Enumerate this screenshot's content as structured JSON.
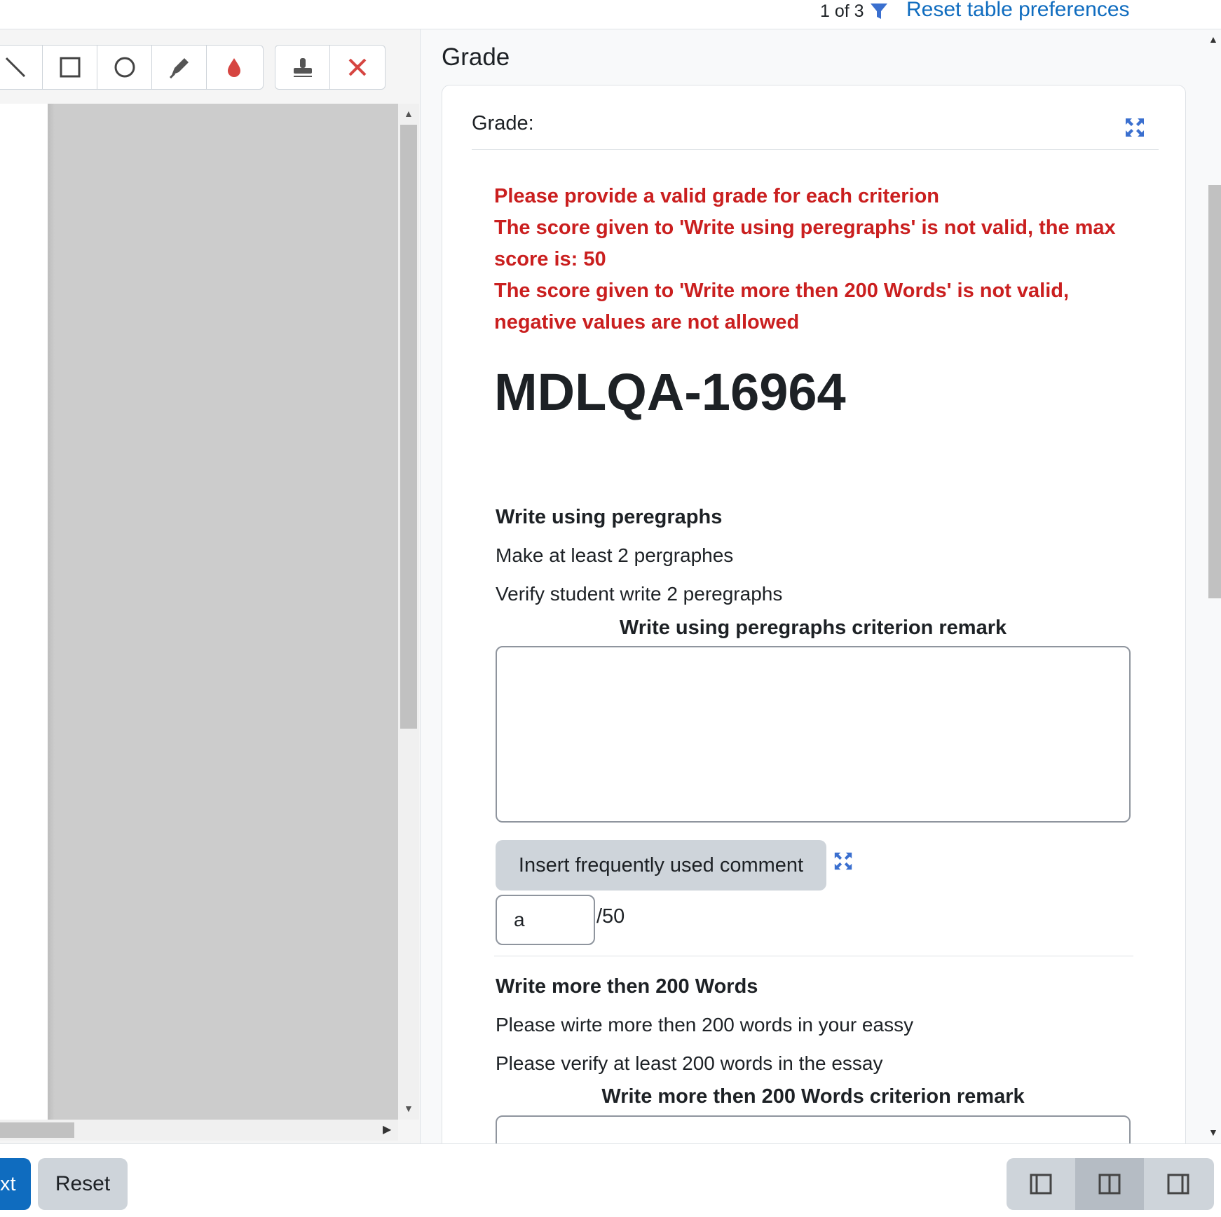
{
  "topbar": {
    "count": "1 of 3",
    "reset_link": "Reset table preferences"
  },
  "toolbar": {
    "tools": [
      "line-icon",
      "rectangle-icon",
      "oval-icon",
      "highlighter-icon",
      "color-picker-icon"
    ],
    "tools2": [
      "stamp-icon",
      "delete-icon"
    ]
  },
  "grade": {
    "heading": "Grade",
    "card_label": "Grade:",
    "errors": [
      "Please provide a valid grade for each criterion",
      "The score given to 'Write using peregraphs' is not valid, the max score is: 50",
      "The score given to 'Write more then 200 Words' is not valid, negative values are not allowed"
    ],
    "title": "MDLQA-16964",
    "criteria": [
      {
        "title": "Write using peregraphs",
        "description": "Make at least 2 pergraphes",
        "guidance": "Verify student write 2 peregraphs",
        "remark_label": "Write using peregraphs criterion remark",
        "remark_value": "",
        "freq_comment_label": "Insert frequently used comment",
        "score_value": "a",
        "max_score": "/50"
      },
      {
        "title": "Write more then 200 Words",
        "description": "Please wirte more then 200 words in your eassy",
        "guidance": "Please verify at least 200 words in the essay",
        "remark_label": "Write more then 200 Words criterion remark"
      }
    ]
  },
  "bottombar": {
    "next_label": "xt",
    "reset_label": "Reset"
  },
  "colors": {
    "error": "#ca1f1f",
    "link": "#0f6cbf",
    "icon_blue": "#3a6fcf"
  }
}
